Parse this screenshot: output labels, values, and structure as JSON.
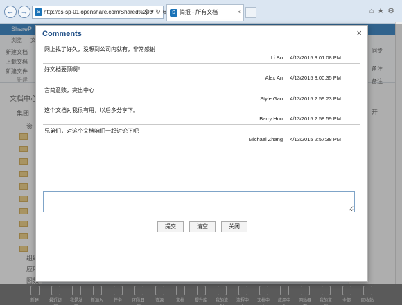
{
  "browser": {
    "url": "http://os-sp-01.openshare.com/Shared%20D",
    "tab_title": "简报 - 所有文档",
    "back_icon": "back-arrow-icon",
    "forward_icon": "forward-arrow-icon"
  },
  "background": {
    "suite_title": "ShareP",
    "ribbon_tabs": [
      "浏览",
      "文"
    ],
    "ribbon_items": [
      "新建文档",
      "上载文档",
      "新建文件",
      "新建"
    ],
    "right_labels": [
      "备注",
      "同步",
      "共享",
      "备注"
    ],
    "left_title": "文档中心",
    "left_tree": [
      "集团",
      "资"
    ],
    "bottom_left_items": [
      "组织",
      "应用",
      "图数"
    ],
    "right_side": "开"
  },
  "dialog": {
    "title": "Comments",
    "close_label": "×",
    "comments": [
      {
        "text": "网上找了好久，没想到公司内就有，非常感谢",
        "author": "Li Bo",
        "time": "4/13/2015 3:01:08 PM"
      },
      {
        "text": "好文档要顶啊！",
        "author": "Alex An",
        "time": "4/13/2015 3:00:35 PM"
      },
      {
        "text": "言简意赅，突出中心",
        "author": "Style Gao",
        "time": "4/13/2015 2:59:23 PM"
      },
      {
        "text": "这个文档对我很有用，以后多分享下。",
        "author": "Barry Hou",
        "time": "4/13/2015 2:58:59 PM"
      },
      {
        "text": "兄弟们，对这个文档咱们一起讨论下吧",
        "author": "Michael Zhang",
        "time": "4/13/2015 2:57:38 PM"
      }
    ],
    "comment_placeholder": "",
    "buttons": {
      "submit": "提交",
      "clear": "清空",
      "close": "关闭"
    }
  },
  "taskbar": {
    "items": [
      "新建",
      "最近访问",
      "我是发布",
      "新加入",
      "任务",
      "团队日历",
      "资源",
      "文档",
      "提升库",
      "我的流程",
      "流程中心",
      "文档中心",
      "应用中心",
      "网站概况",
      "我的文档",
      "全部",
      "回收站"
    ]
  }
}
